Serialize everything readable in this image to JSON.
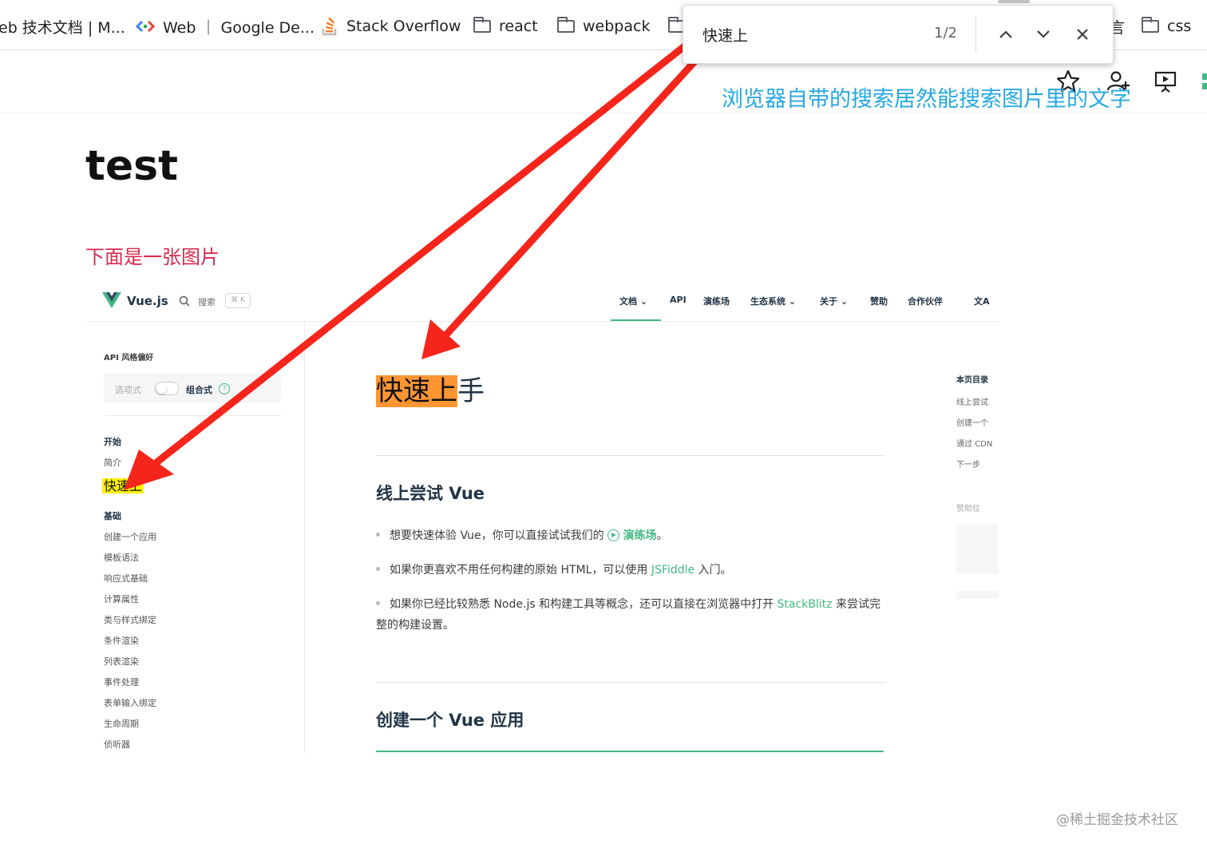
{
  "bookmarks": [
    {
      "label": "eb 技术文档 | M...",
      "icon": "mdn-icon"
    },
    {
      "label": "Web ｜ Google De...",
      "icon": "google-dev-icon"
    },
    {
      "label": "Stack Overflow",
      "icon": "stackoverflow-icon"
    },
    {
      "label": "react",
      "icon": "folder-icon"
    },
    {
      "label": "webpack",
      "icon": "folder-icon"
    },
    {
      "label": "言",
      "icon": "folder-icon"
    },
    {
      "label": "css",
      "icon": "folder-icon"
    }
  ],
  "find_bar": {
    "query": "快速上",
    "count": "1/2"
  },
  "annotation": "浏览器自带的搜索居然能搜索图片里的文字",
  "page": {
    "title": "test",
    "subtitle": "下面是一张图片"
  },
  "vue": {
    "brand": "Vue.js",
    "search": "搜索",
    "kbd": "⌘ K",
    "nav": [
      "文档 ⌄",
      "API",
      "演练场",
      "生态系统 ⌄",
      "关于 ⌄",
      "赞助",
      "合作伙伴",
      "文A"
    ],
    "sidebar": {
      "pref_label": "API 风格偏好",
      "toggle_left": "选项式",
      "toggle_right": "组合式",
      "group1": "开始",
      "item_intro": "简介",
      "item_quick": "快速上",
      "group2": "基础",
      "items": [
        "创建一个应用",
        "模板语法",
        "响应式基础",
        "计算属性",
        "类与样式绑定",
        "条件渲染",
        "列表渲染",
        "事件处理",
        "表单输入绑定",
        "生命周期",
        "侦听器"
      ]
    },
    "heading_hl": "快速上",
    "heading_rest": "手",
    "section1": "线上尝试 Vue",
    "li1_a": "想要快速体验 Vue，你可以直接试试我们的",
    "li1_link": "演练场",
    "li1_b": "。",
    "li2_a": "如果你更喜欢不用任何构建的原始 HTML，可以使用",
    "li2_link": "JSFiddle",
    "li2_b": "入门。",
    "li3_a": "如果你已经比较熟悉 Node.js 和构建工具等概念，还可以直接在浏览器中打开",
    "li3_link": "StackBlitz",
    "li3_b": "来尝试完整的构建设置。",
    "section2": "创建一个 Vue 应用",
    "toc": {
      "title": "本页目录",
      "items": [
        "线上尝试",
        "创建一个",
        "通过 CDN",
        "下一步"
      ],
      "sponsor": "赞助位"
    }
  },
  "watermark": "@稀土掘金技术社区",
  "colors": {
    "annotation": "#27a7e1",
    "subtitle": "#d82a4f",
    "vue_green": "#42b883",
    "arrow": "#f5251b",
    "hl_orange": "#ff9632",
    "hl_yellow": "#fff200"
  }
}
